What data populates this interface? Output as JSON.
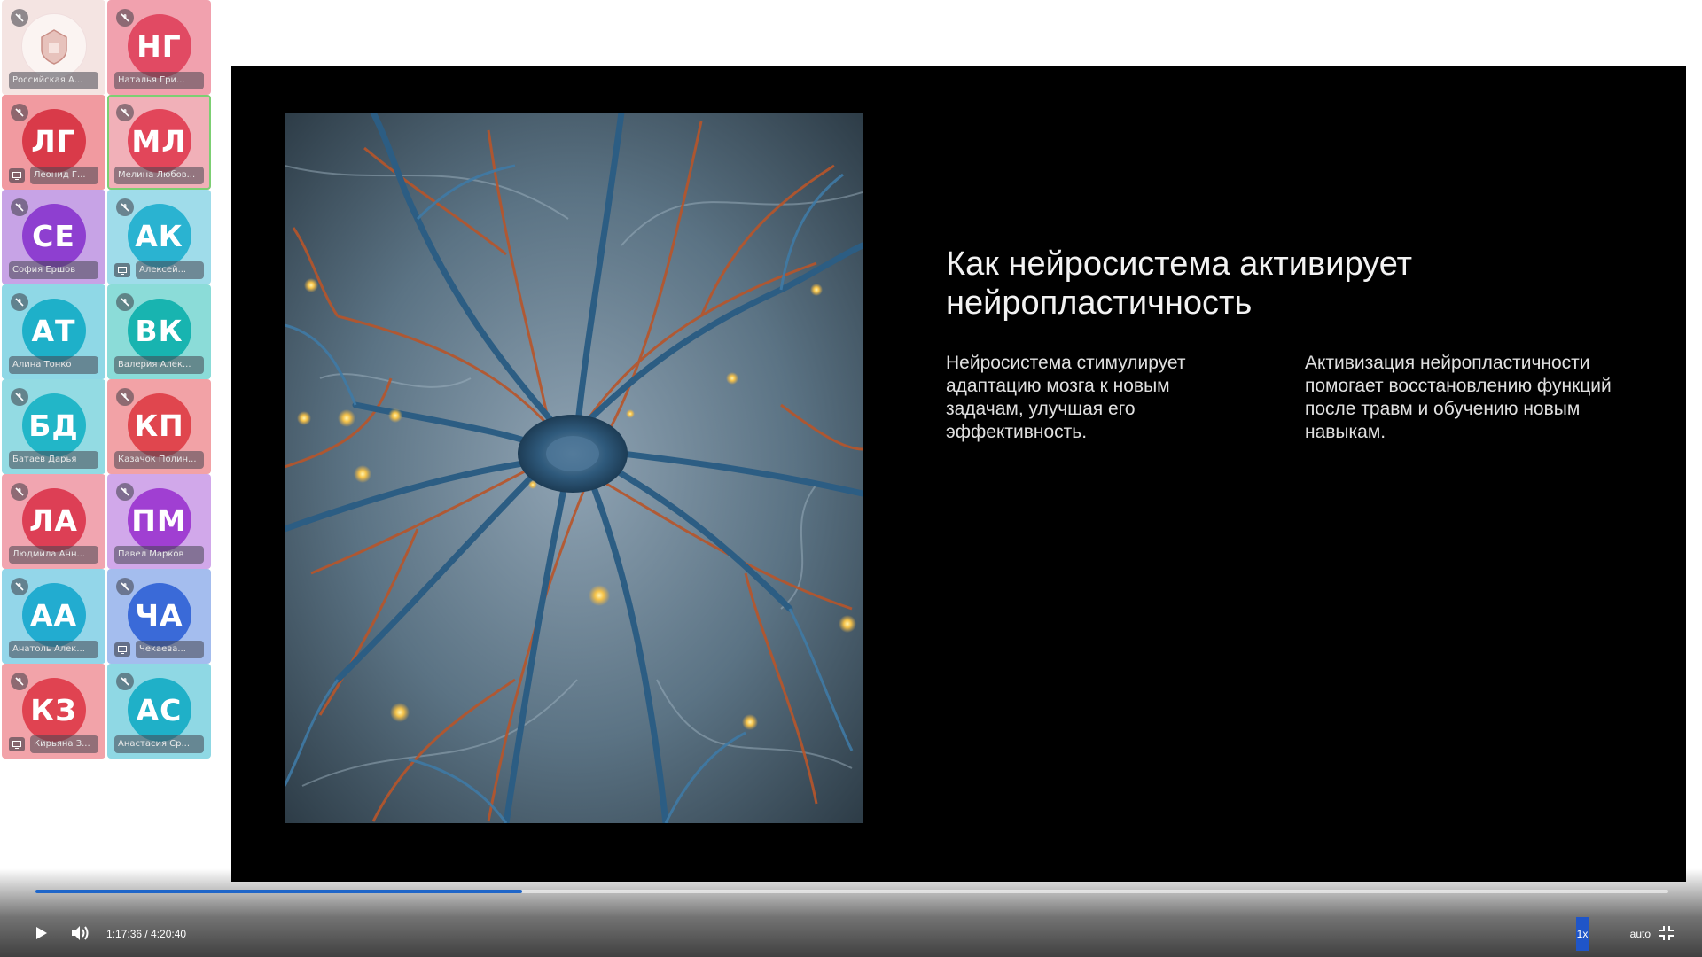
{
  "participants": [
    {
      "initials": "",
      "name": "Российская А...",
      "color": "#fbe8e6",
      "bg": "#f4e4e2",
      "logo": true,
      "screen": false,
      "active": false
    },
    {
      "initials": "НГ",
      "name": "Наталья Гри...",
      "color": "#e14a63",
      "bg": "#f1a1ae",
      "logo": false,
      "screen": false,
      "active": false
    },
    {
      "initials": "ЛГ",
      "name": "Леонид Г...",
      "color": "#d93a49",
      "bg": "#f19aa0",
      "logo": false,
      "screen": true,
      "active": false
    },
    {
      "initials": "МЛ",
      "name": "Мелина Любов...",
      "color": "#e2465a",
      "bg": "#f1b0b8",
      "logo": false,
      "screen": false,
      "active": true
    },
    {
      "initials": "СЕ",
      "name": "София Ершов",
      "color": "#8e3fd0",
      "bg": "#c7a3e6",
      "logo": false,
      "screen": false,
      "active": false
    },
    {
      "initials": "АК",
      "name": "Алексей...",
      "color": "#2ab3d1",
      "bg": "#9fdcea",
      "logo": false,
      "screen": true,
      "active": false
    },
    {
      "initials": "АТ",
      "name": "Алина Тонко",
      "color": "#1eb0c9",
      "bg": "#8fd8e6",
      "logo": false,
      "screen": false,
      "active": false
    },
    {
      "initials": "ВК",
      "name": "Валерия Алек...",
      "color": "#18b4b0",
      "bg": "#8bdcd8",
      "logo": false,
      "screen": false,
      "active": false
    },
    {
      "initials": "БД",
      "name": "Батаев Дарья",
      "color": "#22b6c8",
      "bg": "#93dbe3",
      "logo": false,
      "screen": false,
      "active": false
    },
    {
      "initials": "КП",
      "name": "Казачок Полин...",
      "color": "#e0464e",
      "bg": "#f2a2a6",
      "logo": false,
      "screen": false,
      "active": false
    },
    {
      "initials": "ЛА",
      "name": "Людмила Анн...",
      "color": "#dd3f55",
      "bg": "#f1a5b0",
      "logo": false,
      "screen": false,
      "active": false
    },
    {
      "initials": "ПМ",
      "name": "Павел Марков",
      "color": "#a03fd2",
      "bg": "#d1a8ea",
      "logo": false,
      "screen": false,
      "active": false
    },
    {
      "initials": "АА",
      "name": "Анатоль Алек...",
      "color": "#22acd0",
      "bg": "#93d6e9",
      "logo": false,
      "screen": false,
      "active": false
    },
    {
      "initials": "ЧА",
      "name": "Чекаева...",
      "color": "#3a6ad8",
      "bg": "#a4bdee",
      "logo": false,
      "screen": true,
      "active": false
    },
    {
      "initials": "КЗ",
      "name": "Кирьяна З...",
      "color": "#e04351",
      "bg": "#f2a3a9",
      "logo": false,
      "screen": true,
      "active": false
    },
    {
      "initials": "АС",
      "name": "Анастасия Ср...",
      "color": "#1fb0c8",
      "bg": "#8fd8e4",
      "logo": false,
      "screen": false,
      "active": false
    }
  ],
  "slide": {
    "title_line1": "Как нейросистема активирует",
    "title_line2": "нейропластичность",
    "left_text": "Нейросистема стимулирует адаптацию мозга к новым задачам, улучшая его эффективность.",
    "right_text": "Активизация нейропластичности помогает восстановлению функций после травм и обучению новым навыкам."
  },
  "player": {
    "time": "1:17:36 / 4:20:40",
    "progress": 0.298,
    "speed": "1x",
    "quality": "auto",
    "accent": "#1f66c9"
  }
}
